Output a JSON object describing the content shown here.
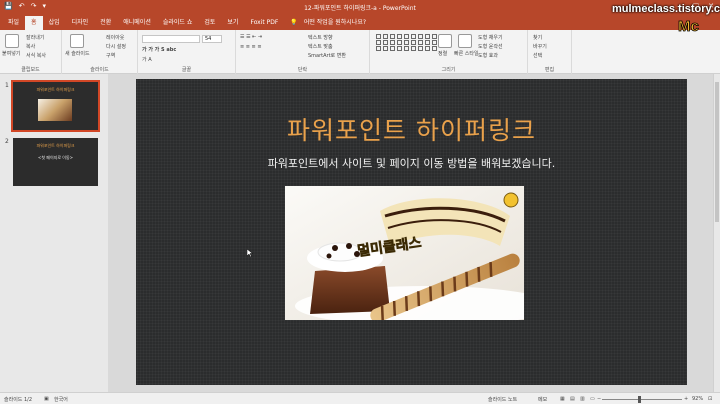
{
  "window": {
    "title": "12-파워포인트 하이퍼링크-a - PowerPoint",
    "buttons": {
      "minimize": "—",
      "maximize": "□",
      "close": "✕"
    }
  },
  "quick_access": {
    "save": "💾",
    "undo": "↶",
    "redo": "↷",
    "customize": "▾"
  },
  "tabs": [
    {
      "label": "파일"
    },
    {
      "label": "홈"
    },
    {
      "label": "삽입"
    },
    {
      "label": "디자인"
    },
    {
      "label": "전환"
    },
    {
      "label": "애니메이션"
    },
    {
      "label": "슬라이드 쇼"
    },
    {
      "label": "검토"
    },
    {
      "label": "보기"
    },
    {
      "label": "Foxit PDF"
    }
  ],
  "tell_me": "어떤 작업을 원하시나요?",
  "ribbon": {
    "clipboard": {
      "label": "클립보드",
      "paste": "붙여넣기",
      "cut": "잘라내기",
      "copy": "복사",
      "format_painter": "서식 복사"
    },
    "slides": {
      "label": "슬라이드",
      "new_slide": "새 슬라이드",
      "layout": "레이아웃",
      "reset": "다시 설정",
      "section": "구역"
    },
    "font": {
      "label": "글꼴",
      "font_name": "",
      "font_size": "54"
    },
    "paragraph": {
      "label": "단락",
      "text_direction": "텍스트 방향",
      "align_text": "텍스트 맞춤",
      "smartart": "SmartArt로 변환"
    },
    "drawing": {
      "label": "그리기",
      "arrange": "정렬",
      "quick_styles": "빠른 스타일",
      "shape_fill": "도형 채우기",
      "shape_outline": "도형 윤곽선",
      "shape_effects": "도형 효과"
    },
    "editing": {
      "label": "편집",
      "find": "찾기",
      "replace": "바꾸기",
      "select": "선택"
    }
  },
  "slides": [
    {
      "number": "1",
      "title": "파워포인트 하이퍼링크"
    },
    {
      "number": "2",
      "title": "파워포인트 하이퍼링크",
      "subtitle": "<첫 페이지로 이동>"
    }
  ],
  "current_slide": {
    "title": "파워포인트 하이퍼링크",
    "subtitle": "파워포인트에서 사이트 및 페이지 이동 방법을 배워보겠습니다.",
    "photo_caption": "멀미클래스"
  },
  "status": {
    "slide_indicator": "슬라이드 1/2",
    "language": "한국어",
    "notes": "슬라이드 노트",
    "comments": "메모",
    "zoom": "92%",
    "zoom_level": 0.46
  },
  "watermark": {
    "text": "mulmeclass.tistory.com",
    "logo": "Mc"
  },
  "colors": {
    "accent": "#b7472a",
    "selection": "#d24726",
    "slide_title": "#e9a14b"
  }
}
